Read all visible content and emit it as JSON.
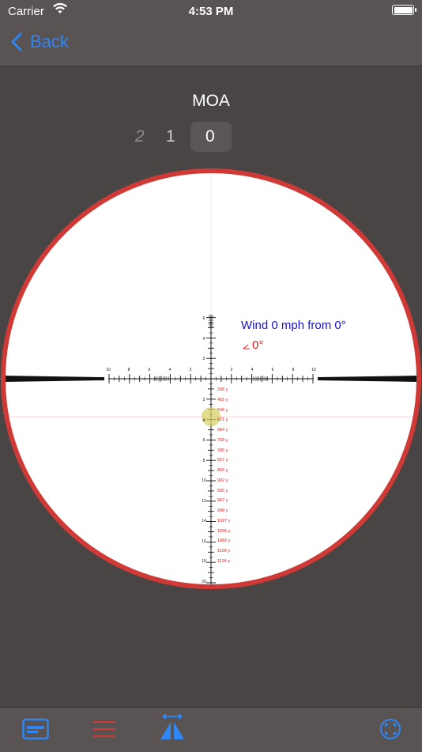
{
  "status": {
    "carrier": "Carrier",
    "time": "4:53 PM"
  },
  "nav": {
    "back_label": "Back",
    "back_icon": "chevron-left-icon"
  },
  "unit": {
    "title": "MOA"
  },
  "picker": {
    "options": [
      "2",
      "1",
      "0"
    ],
    "selected": "0"
  },
  "wind": {
    "text": "Wind 0 mph from 0°",
    "angle_text": "0°",
    "color": "#1a12c9"
  },
  "reticle": {
    "h_labels": [
      "10",
      "8",
      "6",
      "4",
      "2",
      "2",
      "4",
      "6",
      "8",
      "10"
    ],
    "top_labels": [
      "6",
      "4",
      "2"
    ],
    "v_labels": [
      "2",
      "4",
      "6",
      "8",
      "10",
      "12",
      "14",
      "16",
      "18",
      "20"
    ],
    "ranges": [
      "338 y",
      "455 y",
      "546 y",
      "621 y",
      "684 y",
      "738 y",
      "785 y",
      "827 y",
      "866 y",
      "902 y",
      "935 y",
      "967 y",
      "998 y",
      "1027 y",
      "1055 y",
      "1082 y",
      "1109 y",
      "1134 y"
    ],
    "range_color": "#e02020",
    "ring_color": "#d03a36"
  },
  "tabs": [
    {
      "name": "card-icon",
      "color": "#2f86f5"
    },
    {
      "name": "list-icon",
      "color": "#d03a36"
    },
    {
      "name": "measure-icon",
      "color": "#2f86f5"
    },
    {
      "name": "focus-icon",
      "color": "#2f86f5"
    }
  ]
}
